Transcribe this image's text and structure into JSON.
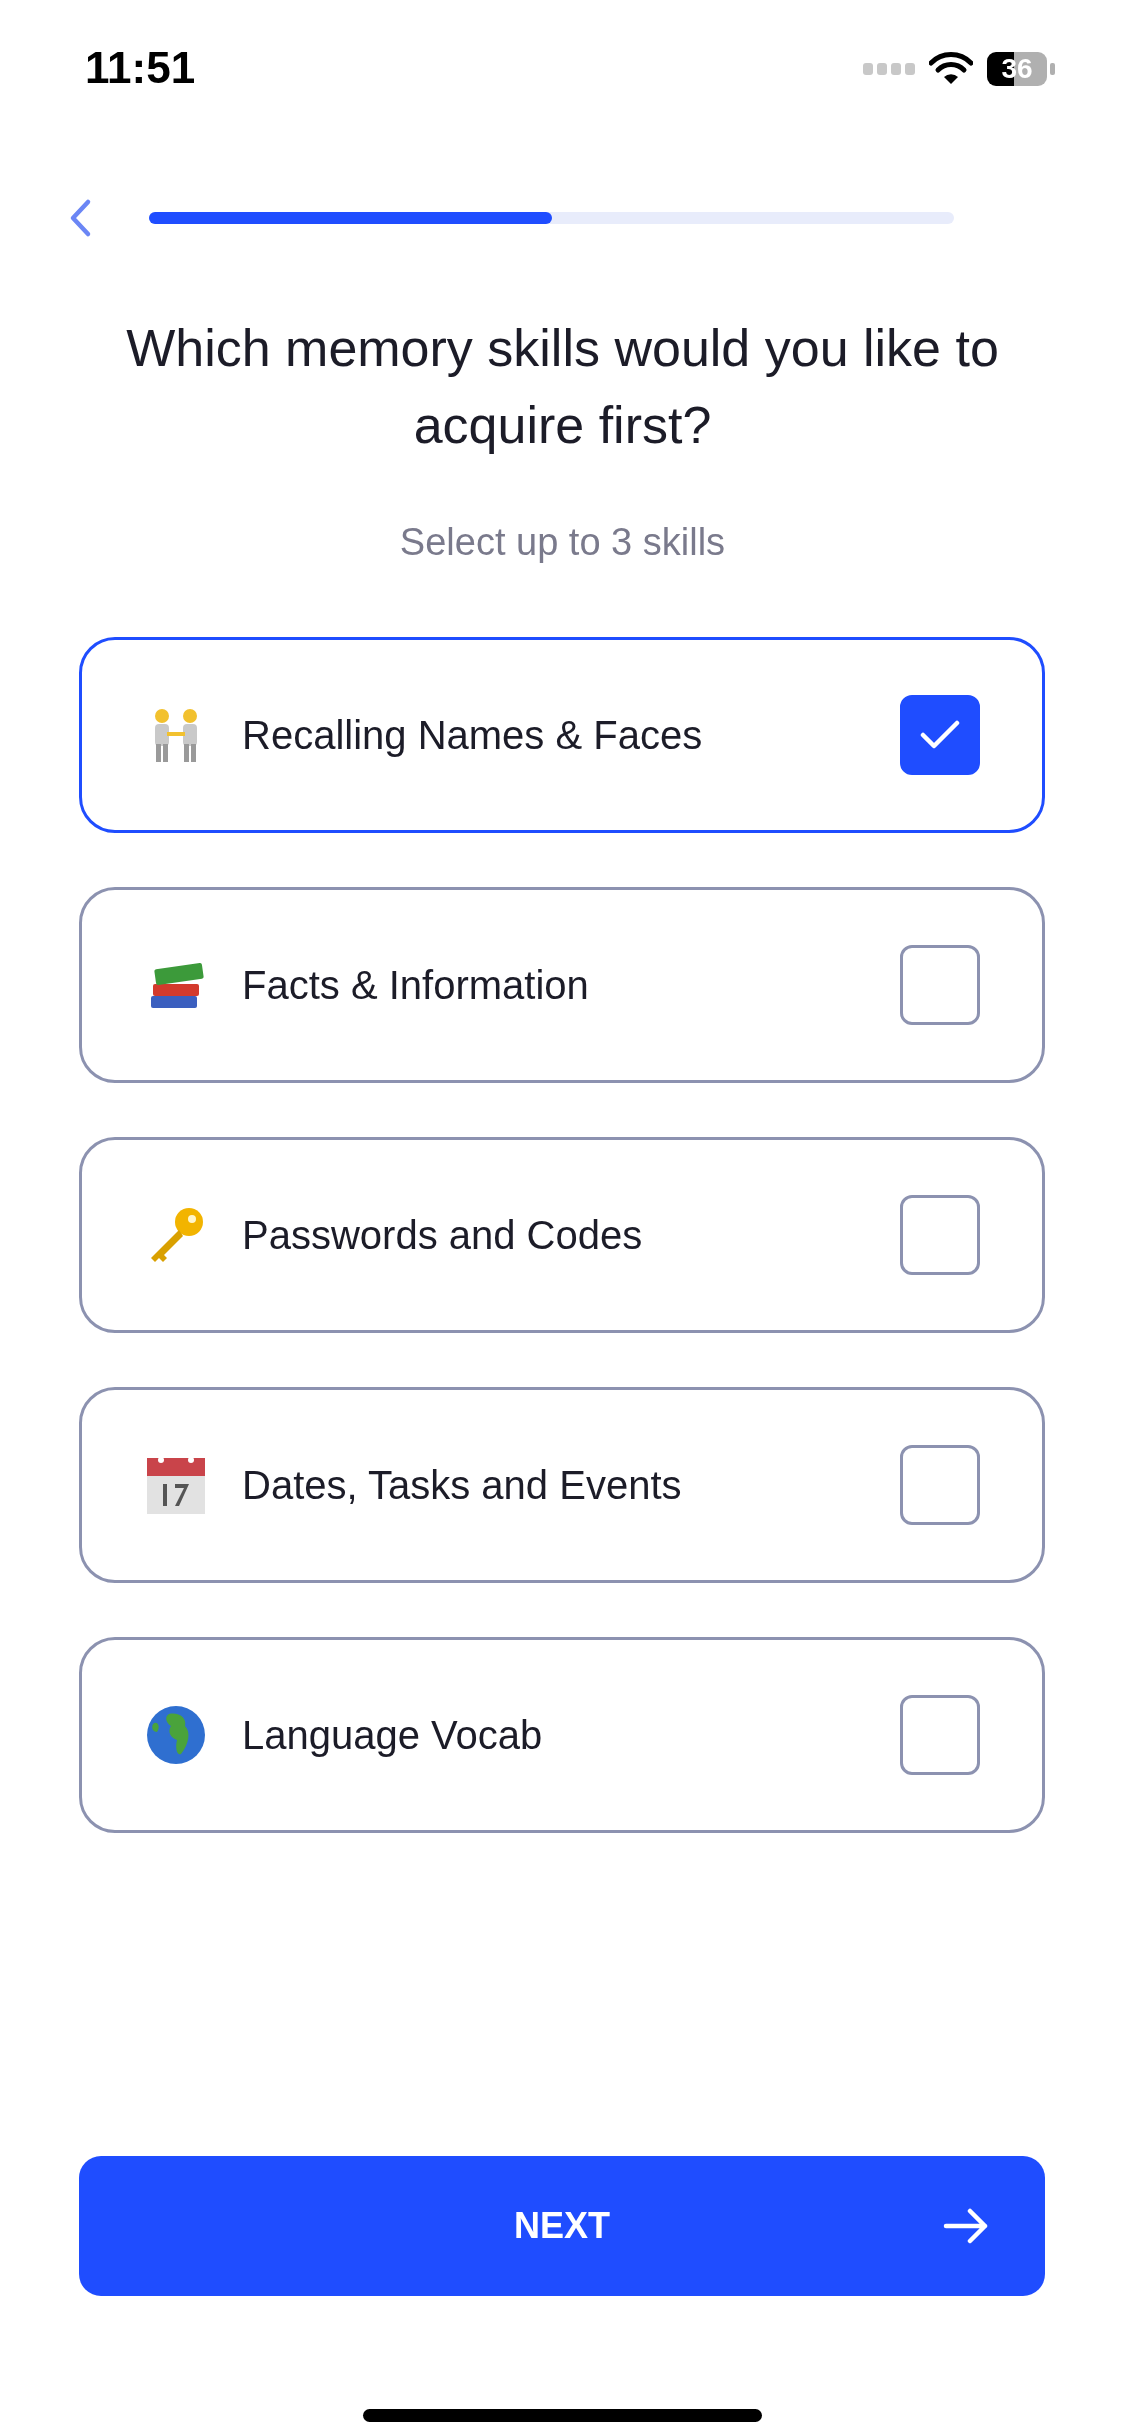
{
  "status_bar": {
    "time": "11:51",
    "battery": "36"
  },
  "progress": {
    "level": 0.5
  },
  "title": "Which memory skills would you like to acquire first?",
  "subtitle": "Select up to 3 skills",
  "items": [
    {
      "kind": "people",
      "label": "Recalling Names & Faces",
      "checked": true
    },
    {
      "kind": "books",
      "label": "Facts & Information",
      "checked": false
    },
    {
      "kind": "key",
      "label": "Passwords and Codes",
      "checked": false
    },
    {
      "kind": "calendar",
      "label": "Dates, Tasks and Events",
      "checked": false
    },
    {
      "kind": "globe",
      "label": "Language Vocab",
      "checked": false
    }
  ],
  "next_button": {
    "label": "NEXT"
  }
}
